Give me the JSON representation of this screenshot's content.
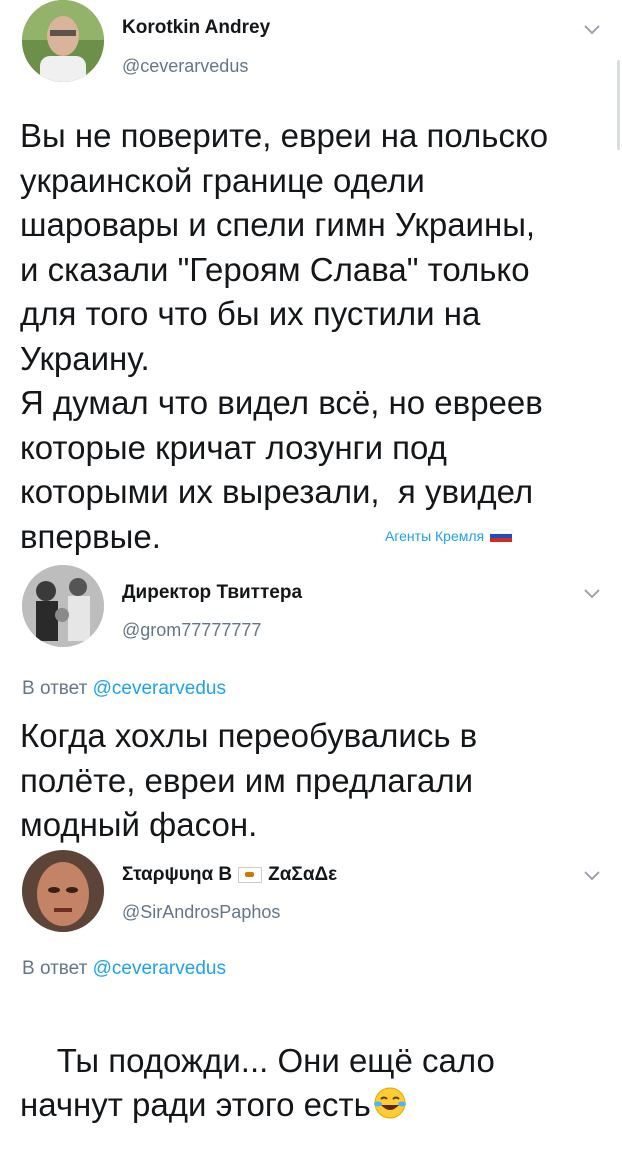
{
  "tweets": [
    {
      "name": "Korotkin Andrey",
      "handle": "@ceverarvedus",
      "text": "Вы не поверите, евреи на польско\nукраинской границе одели\nшаровары и спели гимн Украины,\nи сказали \"Героям Слава\" только\nдля того что бы их пустили на\nУкраину.\nЯ думал что видел всё, но евреев\nкоторые кричат лозунги под\nкоторыми их вырезали,  я увидел\nвпервые."
    },
    {
      "name": "Директор Твиттера",
      "handle": "@grom77777777",
      "reply_prefix": "В ответ",
      "reply_handle": "@ceverarvedus",
      "text": "Когда хохлы переобувались в\nполёте, евреи им предлагали\nмодный фасон."
    },
    {
      "name_part1": "Σταρψυηα Β",
      "name_part2": "ΖαΣαΔε",
      "handle": "@SirAndrosPaphos",
      "reply_prefix": "В ответ",
      "reply_handle": "@ceverarvedus",
      "text": "Ты подожди... Они ещё сало\nначнут ради этого есть"
    }
  ],
  "watermark": "Агенты Кремля",
  "icons": {
    "chevron": "chevron-down-icon",
    "flag_ru": "russia-flag-icon",
    "flag_cy": "cyprus-flag-icon",
    "laugh": "face-with-tears-of-joy-icon"
  }
}
